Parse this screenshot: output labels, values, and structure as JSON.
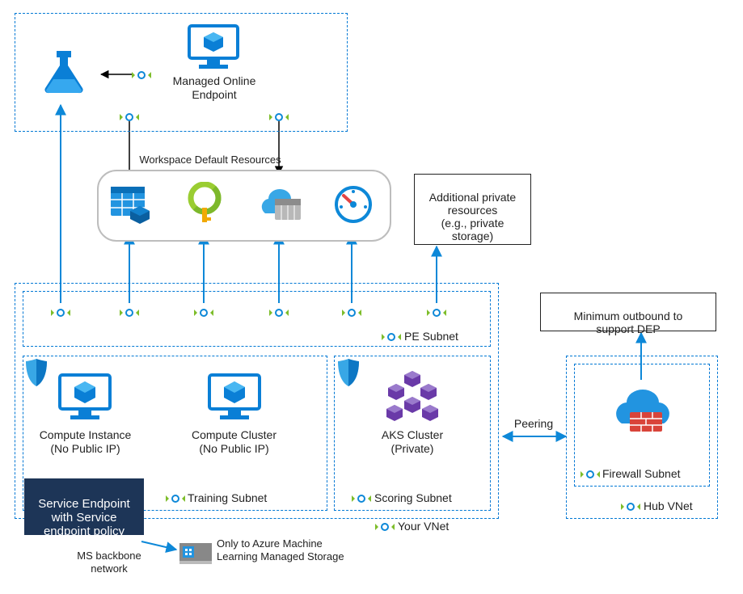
{
  "top": {
    "managed_endpoint": "Managed Online\nEndpoint"
  },
  "workspace": {
    "title": "Workspace Default Resources"
  },
  "additional_resources": "Additional private\nresources\n(e.g., private\nstorage)",
  "pe_subnet": "PE Subnet",
  "training_subnet": "Training Subnet",
  "scoring_subnet": "Scoring Subnet",
  "your_vnet": "Your VNet",
  "hub_vnet": "Hub VNet",
  "firewall_subnet": "Firewall Subnet",
  "compute_instance": "Compute Instance\n(No Public IP)",
  "compute_cluster": "Compute Cluster\n(No Public IP)",
  "aks_cluster": "AKS Cluster\n(Private)",
  "peering": "Peering",
  "min_outbound": "Minimum outbound to\nsupport DEP",
  "service_endpoint_box": "Service Endpoint\nwith  Service\nendpoint policy",
  "ms_backbone": "MS backbone\nnetwork",
  "ml_storage_note": "Only to Azure Machine\nLearning Managed Storage"
}
